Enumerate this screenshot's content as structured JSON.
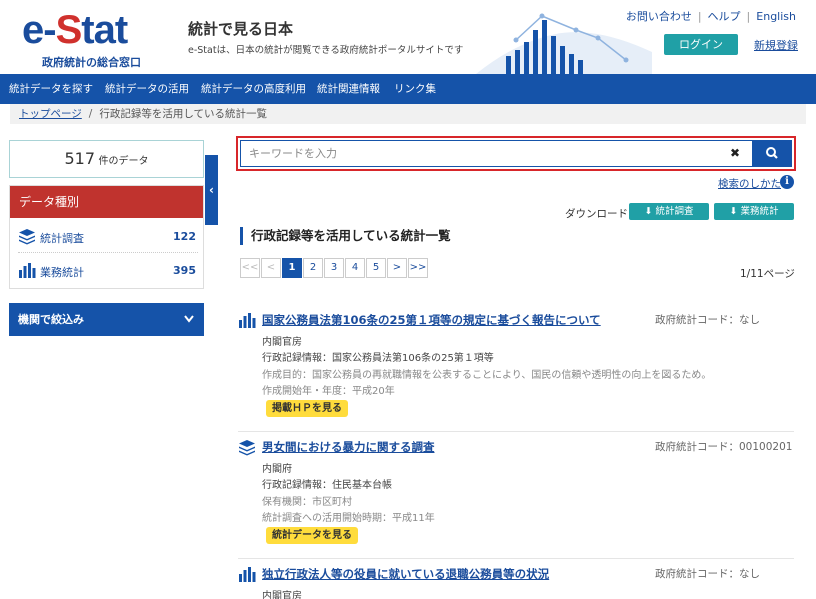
{
  "header": {
    "logo_text_1": "e-",
    "logo_text_2": "S",
    "logo_text_3": "tat",
    "logo_sub": "政府統計の総合窓口",
    "site_title": "統計で見る日本",
    "site_desc": "e-Statは、日本の統計が閲覧できる政府統計ポータルサイトです",
    "links": [
      "お問い合わせ",
      "ヘルプ",
      "English"
    ],
    "login_label": "ログイン",
    "register_label": "新規登録"
  },
  "nav": {
    "items": [
      "統計データを探す",
      "統計データの活用",
      "統計データの高度利用",
      "統計関連情報",
      "リンク集"
    ]
  },
  "breadcrumb": {
    "home": "トップページ",
    "separator": "/",
    "current": "行政記録等を活用している統計一覧"
  },
  "sidebar": {
    "count_value": "517",
    "count_unit": "件のデータ",
    "collapse_glyph": "‹",
    "data_type_heading": "データ種別",
    "data_types": [
      {
        "label": "統計調査",
        "count": "122",
        "icon": "stack-icon"
      },
      {
        "label": "業務統計",
        "count": "395",
        "icon": "bar-chart-icon"
      }
    ],
    "filter_label": "機関で絞込み",
    "filter_chevron": "⌄"
  },
  "search": {
    "placeholder": "キーワードを入力",
    "clear_glyph": "✖",
    "help_label": "検索のしかた",
    "info_glyph": "i"
  },
  "download": {
    "label": "ダウンロード:",
    "buttons": [
      "⬇ 統計調査",
      "⬇ 業務統計"
    ]
  },
  "section_title": "行政記録等を活用している統計一覧",
  "pagination": {
    "items": [
      "<<",
      "<",
      "1",
      "2",
      "3",
      "4",
      "5",
      ">",
      ">>"
    ],
    "current_page": 1,
    "page_info": "1/11ページ"
  },
  "results": [
    {
      "icon": "bar-chart-icon",
      "title": "国家公務員法第106条の25第１項等の規定に基づく報告について",
      "code": "政府統計コード：なし",
      "org": "内閣官房",
      "record_info": "行政記録情報：国家公務員法第106条の25第１項等",
      "line3": "作成目的：国家公務員の再就職情報を公表することにより、国民の信頼や透明性の向上を図るため。",
      "line4": "作成開始年・年度：平成20年",
      "badge": "掲載ＨＰを見る"
    },
    {
      "icon": "stack-icon",
      "title": "男女間における暴力に関する調査",
      "code": "政府統計コード：00100201",
      "org": "内閣府",
      "record_info": "行政記録情報：住民基本台帳",
      "line3": "保有機関：市区町村",
      "line4": "統計調査への活用開始時期：平成11年",
      "badge": "統計データを見る"
    },
    {
      "icon": "bar-chart-icon",
      "title": "独立行政法人等の役員に就いている退職公務員等の状況",
      "code": "政府統計コード：なし",
      "org": "内閣官房"
    }
  ],
  "colors": {
    "brand_blue": "#1553a9",
    "brand_red": "#c0332e",
    "teal": "#20a0a6",
    "badge_yellow": "#ffdc3c",
    "highlight_red": "#d8262a"
  }
}
